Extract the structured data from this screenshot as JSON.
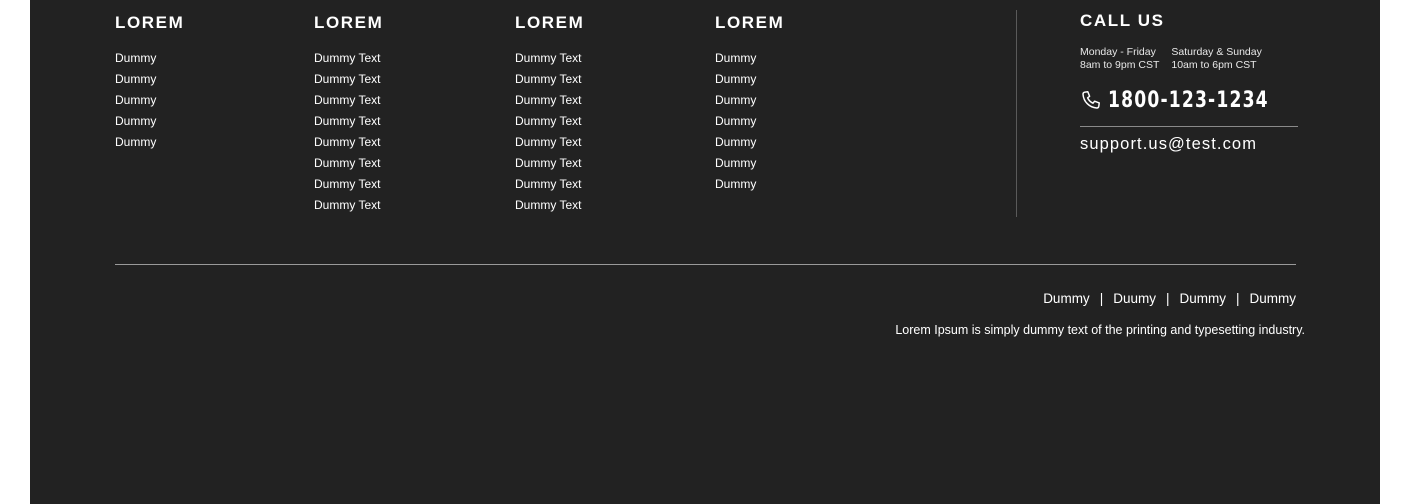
{
  "columns": [
    {
      "title": "LOREM",
      "items": [
        "Dummy",
        "Dummy",
        "Dummy",
        "Dummy",
        "Dummy"
      ]
    },
    {
      "title": "LOREM",
      "items": [
        "Dummy Text",
        "Dummy Text",
        "Dummy Text",
        "Dummy Text",
        "Dummy Text",
        "Dummy Text",
        "Dummy Text",
        "Dummy Text"
      ]
    },
    {
      "title": "LOREM",
      "items": [
        "Dummy Text",
        "Dummy Text",
        "Dummy Text",
        "Dummy Text",
        "Dummy Text",
        "Dummy Text",
        "Dummy Text",
        "Dummy Text"
      ]
    },
    {
      "title": "LOREM",
      "items": [
        "Dummy",
        "Dummy",
        "Dummy",
        "Dummy",
        "Dummy",
        "Dummy",
        "Dummy"
      ]
    }
  ],
  "call_us": {
    "title": "CALL US",
    "weekday_days": "Monday - Friday",
    "weekday_hours": "8am to 9pm CST",
    "weekend_days": "Saturday & Sunday",
    "weekend_hours": "10am to 6pm CST",
    "phone_icon": "phone-icon",
    "phone": "1800-123-1234",
    "email": "support.us@test.com"
  },
  "bottom": {
    "links": [
      "Dummy",
      "Duumy",
      "Dummy",
      "Dummy"
    ],
    "separator": "|",
    "tagline": "Lorem Ipsum is simply dummy text of the printing and typesetting industry."
  },
  "colors": {
    "background": "#222222",
    "text": "#ffffff",
    "divider": "#9a9a9a"
  }
}
